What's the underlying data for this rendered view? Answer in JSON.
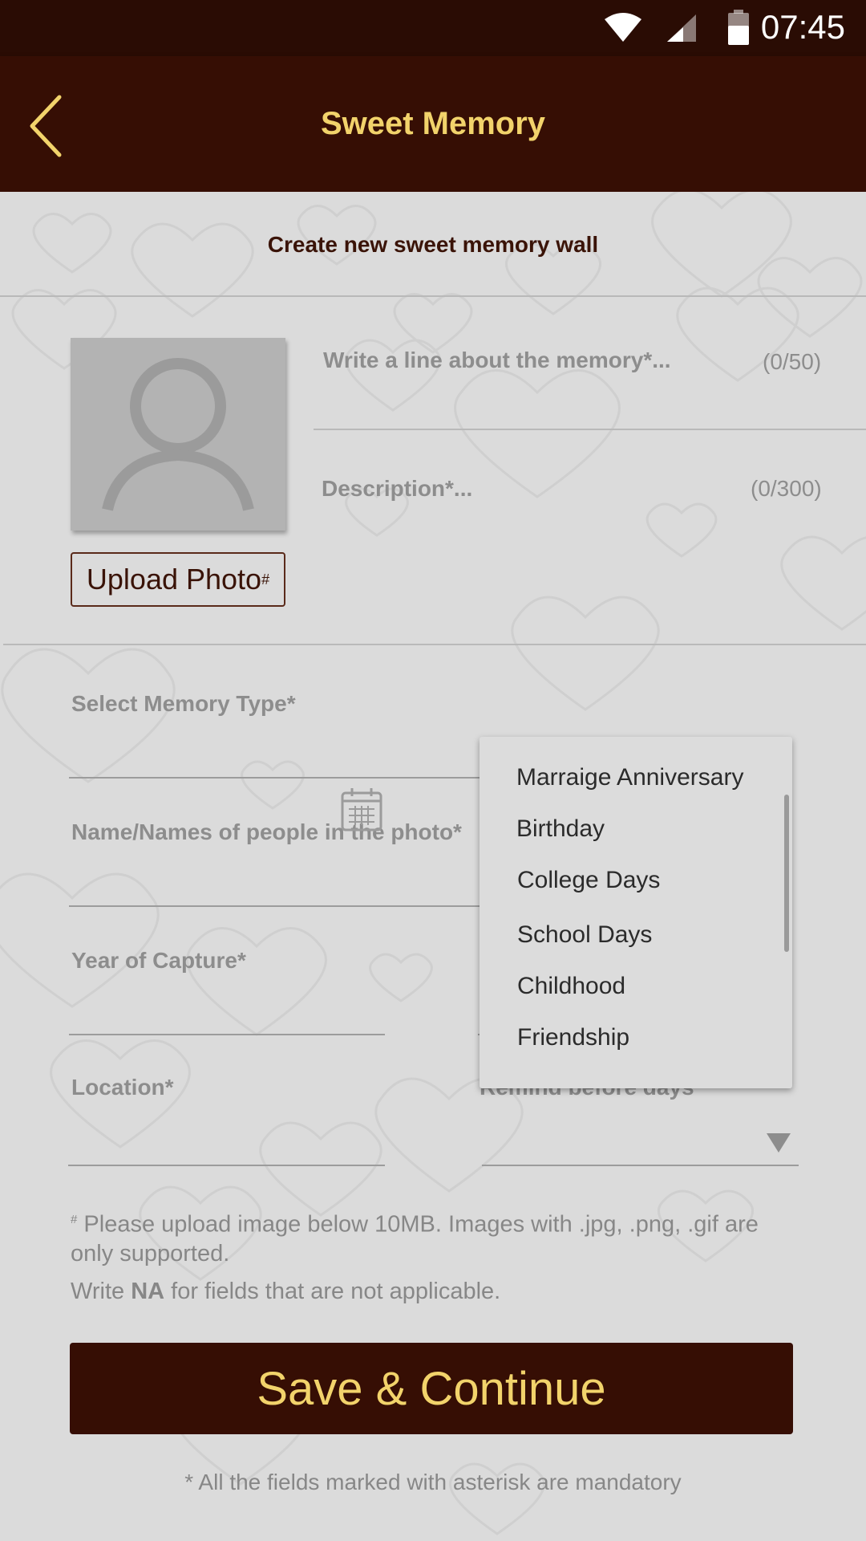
{
  "status_bar": {
    "time": "07:45",
    "icons": [
      "wifi-icon",
      "cell-signal-icon",
      "battery-icon"
    ]
  },
  "app_bar": {
    "title": "Sweet Memory",
    "back_icon": "chevron-left-icon"
  },
  "colors": {
    "header_bg": "#360e04",
    "status_bg": "#2a0c04",
    "accent_text": "#f2d36b",
    "page_bg": "#dbdbdb"
  },
  "form": {
    "subtitle": "Create new sweet memory wall",
    "upload_label": "Upload Photo",
    "upload_mark": "#",
    "line_placeholder": "Write a line about the memory*...",
    "line_counter": "(0/50)",
    "description_placeholder": "Description*...",
    "description_counter": "(0/300)",
    "memory_type_label": "Select Memory Type*",
    "names_label": "Name/Names of people in the photo*",
    "year_label": "Year of Capture*",
    "location_label": "Location*",
    "remind_label": "Remind before days"
  },
  "notes": {
    "upload_mark": "#",
    "upload_note_line1": "Please upload image below 10MB. Images with .jpg, .png, .gif are",
    "upload_note_line2": "only supported.",
    "na_prefix": "Write ",
    "na_bold": "NA",
    "na_suffix": " for fields that are not applicable."
  },
  "save_button": "Save & Continue",
  "mandatory_note": "* All the fields marked with asterisk are mandatory",
  "dropdown": {
    "options": [
      "Marraige Anniversary",
      "Birthday",
      "College Days",
      "School Days",
      "Childhood",
      "Friendship"
    ]
  }
}
